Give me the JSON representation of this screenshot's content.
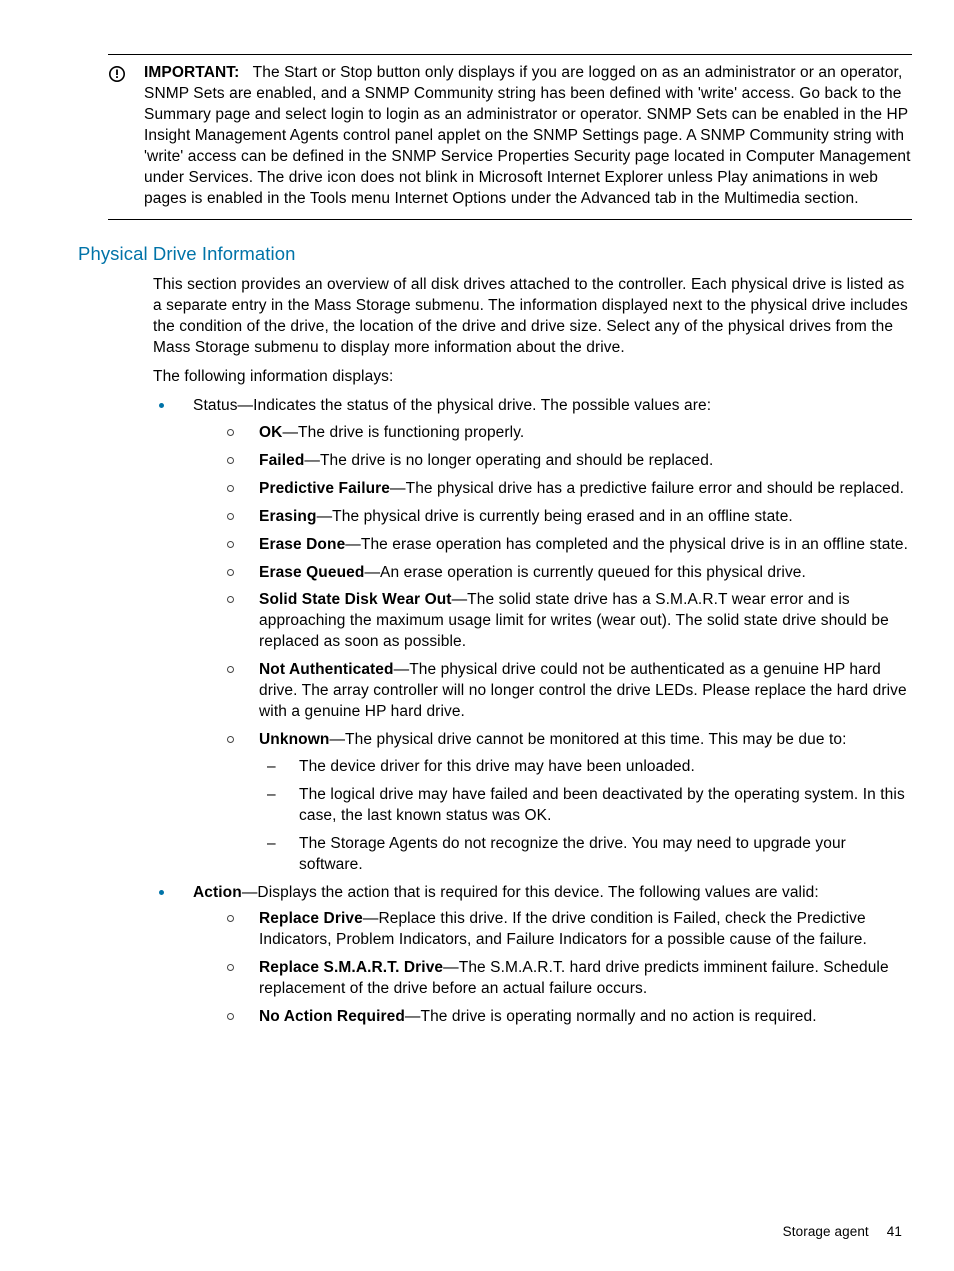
{
  "important": {
    "label": "IMPORTANT:",
    "text": "The Start or Stop button only displays if you are logged on as an administrator or an operator, SNMP Sets are enabled, and a SNMP Community string has been defined with 'write' access. Go back to the Summary page and select login to login as an administrator or operator. SNMP Sets can be enabled in the HP Insight Management Agents control panel applet on the SNMP Settings page. A SNMP Community string with 'write' access can be defined in the SNMP Service Properties Security page located in Computer Management under Services. The drive icon does not blink in Microsoft Internet Explorer unless Play animations in web pages is enabled in the Tools menu Internet Options under the Advanced tab in the Multimedia section."
  },
  "section": {
    "heading": "Physical Drive Information",
    "intro": "This section provides an overview of all disk drives attached to the controller. Each physical drive is listed as a separate entry in the Mass Storage submenu. The information displayed next to the physical drive includes the condition of the drive, the location of the drive and drive size. Select any of the physical drives from the Mass Storage submenu to display more information about the drive.",
    "lead": "The following information displays:"
  },
  "status": {
    "intro": "Status—Indicates the status of the physical drive. The possible values are:",
    "items": {
      "ok": {
        "label": "OK",
        "text": "—The drive is functioning properly."
      },
      "failed": {
        "label": "Failed",
        "text": "—The drive is no longer operating and should be replaced."
      },
      "predict": {
        "label": "Predictive Failure",
        "text": "—The physical drive has a predictive failure error and should be replaced."
      },
      "erasing": {
        "label": "Erasing",
        "text": "—The physical drive is currently being erased and in an offline state."
      },
      "erasedone": {
        "label": "Erase Done",
        "text": "—The erase operation has completed and the physical drive is in an offline state."
      },
      "eraseq": {
        "label": "Erase Queued",
        "text": "—An erase operation is currently queued for this physical drive."
      },
      "ssdwear": {
        "label": "Solid State Disk Wear Out",
        "text": "—The solid state drive has a S.M.A.R.T wear error and is approaching the maximum usage limit for writes (wear out). The solid state drive should be replaced as soon as possible."
      },
      "notauth": {
        "label": "Not Authenticated",
        "text": "—The physical drive could not be authenticated as a genuine HP hard drive. The array controller will no longer control the drive LEDs. Please replace the hard drive with a genuine HP hard drive."
      },
      "unknown": {
        "label": "Unknown",
        "text": "—The physical drive cannot be monitored at this time. This may be due to:"
      }
    },
    "unknownSub": {
      "a": "The device driver for this drive may have been unloaded.",
      "b": "The logical drive may have failed and been deactivated by the operating system. In this case, the last known status was OK.",
      "c": "The Storage Agents do not recognize the drive. You may need to upgrade your software."
    }
  },
  "action": {
    "label": "Action",
    "intro": "—Displays the action that is required for this device. The following values are valid:",
    "items": {
      "replace": {
        "label": "Replace Drive",
        "text": "—Replace this drive. If the drive condition is Failed, check the Predictive Indicators, Problem Indicators, and Failure Indicators for a possible cause of the failure."
      },
      "smart": {
        "label": "Replace S.M.A.R.T. Drive",
        "text": "—The S.M.A.R.T. hard drive predicts imminent failure. Schedule replacement of the drive before an actual failure occurs."
      },
      "noaction": {
        "label": "No Action Required",
        "text": "—The drive is operating normally and no action is required."
      }
    }
  },
  "footer": {
    "section": "Storage agent",
    "page": "41"
  }
}
